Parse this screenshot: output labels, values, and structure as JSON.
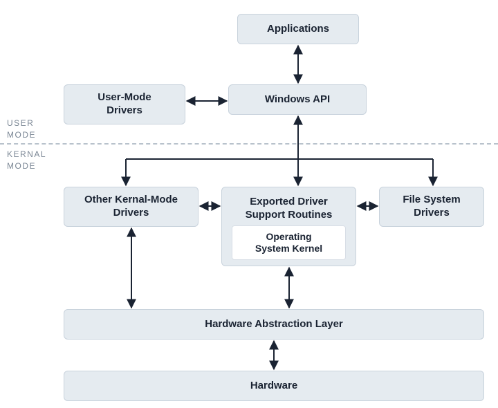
{
  "labels": {
    "user_mode": "USER\nMODE",
    "kernel_mode": "KERNAL\nMODE"
  },
  "boxes": {
    "applications": "Applications",
    "user_mode_drivers": "User-Mode\nDrivers",
    "windows_api": "Windows API",
    "other_kernel_drivers": "Other Kernal-Mode\nDrivers",
    "exported_routines": "Exported Driver\nSupport Routines",
    "os_kernel": "Operating\nSystem Kernel",
    "file_system_drivers": "File System\nDrivers",
    "hal": "Hardware Abstraction Layer",
    "hardware": "Hardware"
  },
  "structure": {
    "description": "Windows driver architecture layered diagram showing user mode and kernel mode separation.",
    "user_mode_nodes": [
      "applications",
      "user_mode_drivers",
      "windows_api"
    ],
    "kernel_mode_nodes": [
      "other_kernel_drivers",
      "exported_routines",
      "os_kernel",
      "file_system_drivers",
      "hal",
      "hardware"
    ],
    "edges_bidirectional": [
      [
        "applications",
        "windows_api"
      ],
      [
        "user_mode_drivers",
        "windows_api"
      ],
      [
        "other_kernel_drivers",
        "exported_routines"
      ],
      [
        "exported_routines",
        "file_system_drivers"
      ],
      [
        "other_kernel_drivers",
        "hal"
      ],
      [
        "exported_routines",
        "hal"
      ],
      [
        "hal",
        "hardware"
      ],
      [
        "windows_api",
        "exported_routines"
      ]
    ],
    "edges_fanout_from_windows_api_down_to": [
      "other_kernel_drivers",
      "exported_routines",
      "file_system_drivers"
    ],
    "nested": {
      "parent": "exported_routines",
      "child": "os_kernel"
    }
  }
}
